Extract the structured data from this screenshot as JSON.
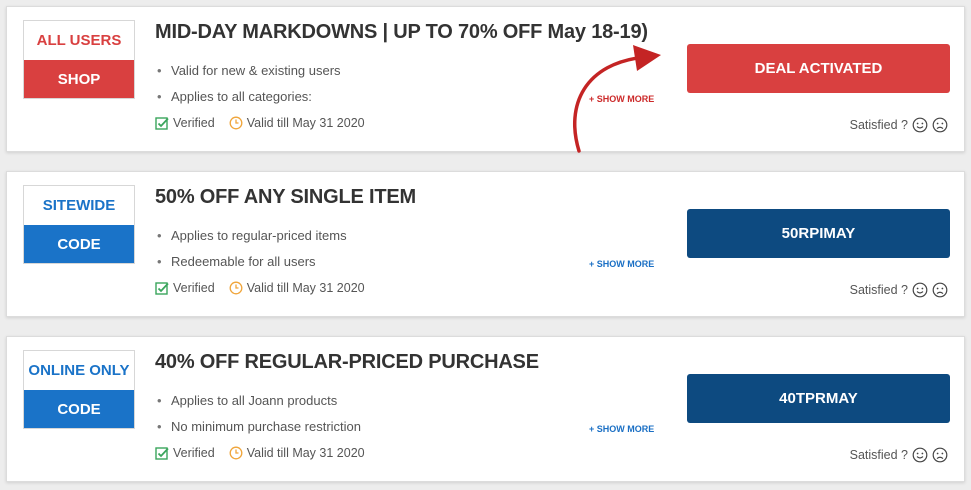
{
  "colors": {
    "red": "#d94040",
    "blue": "#1a73c8",
    "navy": "#0d4a80",
    "link_red": "#cc2a2a",
    "link_blue": "#1a6fc4",
    "green": "#3aa55c",
    "orange": "#f0a53a"
  },
  "cards": [
    {
      "badge_top": "ALL USERS",
      "badge_bottom": "SHOP",
      "title": "MID-DAY MARKDOWNS | UP TO 70% OFF May 18-19)",
      "bullets": [
        "Valid for new & existing users",
        "Applies to all categories:"
      ],
      "show_more": "+ SHOW MORE",
      "verified": "Verified",
      "valid_till": "Valid till May 31 2020",
      "action_label": "DEAL ACTIVATED",
      "satisfied": "Satisfied ?",
      "icons": [
        "check-square-icon",
        "clock-icon",
        "smile-icon",
        "frown-icon",
        "curved-arrow-icon"
      ]
    },
    {
      "badge_top": "SITEWIDE",
      "badge_bottom": "CODE",
      "title": "50% OFF ANY SINGLE ITEM",
      "bullets": [
        "Applies to regular-priced items",
        "Redeemable for all users"
      ],
      "show_more": "+ SHOW MORE",
      "verified": "Verified",
      "valid_till": "Valid till May 31 2020",
      "action_label": "50RPIMAY",
      "satisfied": "Satisfied ?",
      "icons": [
        "check-square-icon",
        "clock-icon",
        "smile-icon",
        "frown-icon"
      ]
    },
    {
      "badge_top": "ONLINE ONLY",
      "badge_bottom": "CODE",
      "title": "40% OFF REGULAR-PRICED PURCHASE",
      "bullets": [
        "Applies to all Joann products",
        "No minimum purchase restriction"
      ],
      "show_more": "+ SHOW MORE",
      "verified": "Verified",
      "valid_till": "Valid till May 31 2020",
      "action_label": "40TPRMAY",
      "satisfied": "Satisfied ?",
      "icons": [
        "check-square-icon",
        "clock-icon",
        "smile-icon",
        "frown-icon"
      ]
    }
  ]
}
